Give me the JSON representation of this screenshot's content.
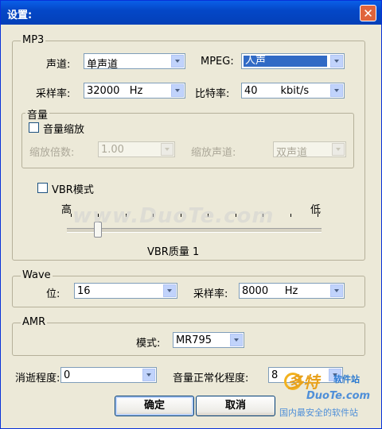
{
  "window": {
    "title": "设置:",
    "close_glyph": "✕"
  },
  "mp3": {
    "legend": "MP3",
    "channel_label": "声道:",
    "channel_value": "单声道",
    "mpeg_label": "MPEG:",
    "mpeg_value": "人声",
    "samplerate_label": "采样率:",
    "samplerate_value": "32000   Hz",
    "bitrate_label": "比特率:",
    "bitrate_value": "40       kbit/s",
    "volume": {
      "legend": "音量",
      "scale_checkbox_label": "音量缩放",
      "scale_checked": false,
      "factor_label": "缩放倍数:",
      "factor_value": "1.00",
      "scale_channel_label": "缩放声道:",
      "scale_channel_value": "双声道"
    },
    "vbr": {
      "checkbox_label": "VBR模式",
      "checked": false,
      "high_label": "高",
      "low_label": "低",
      "quality_label": "VBR质量  1",
      "quality_value": 1,
      "ticks": 10
    }
  },
  "wave": {
    "legend": "Wave",
    "bits_label": "位:",
    "bits_value": "16",
    "samplerate_label": "采样率:",
    "samplerate_value": "8000     Hz"
  },
  "amr": {
    "legend": "AMR",
    "mode_label": "模式:",
    "mode_value": "MR795"
  },
  "fade_label": "消逝程度:",
  "fade_value": "0",
  "normalize_label": "音量正常化程度:",
  "normalize_value": "8",
  "ok_label": "确定",
  "cancel_label": "取消",
  "watermark": {
    "text": "www.DuoTe.com",
    "logo_cn": "多特",
    "logo_cn2": "软件站",
    "logo_en": "DuoTe.com",
    "logo_sub": "国内最安全的软件站"
  },
  "colors": {
    "titlebar": "#0A5FE8",
    "dialog": "#ECE9D8",
    "selection": "#316AC5"
  }
}
